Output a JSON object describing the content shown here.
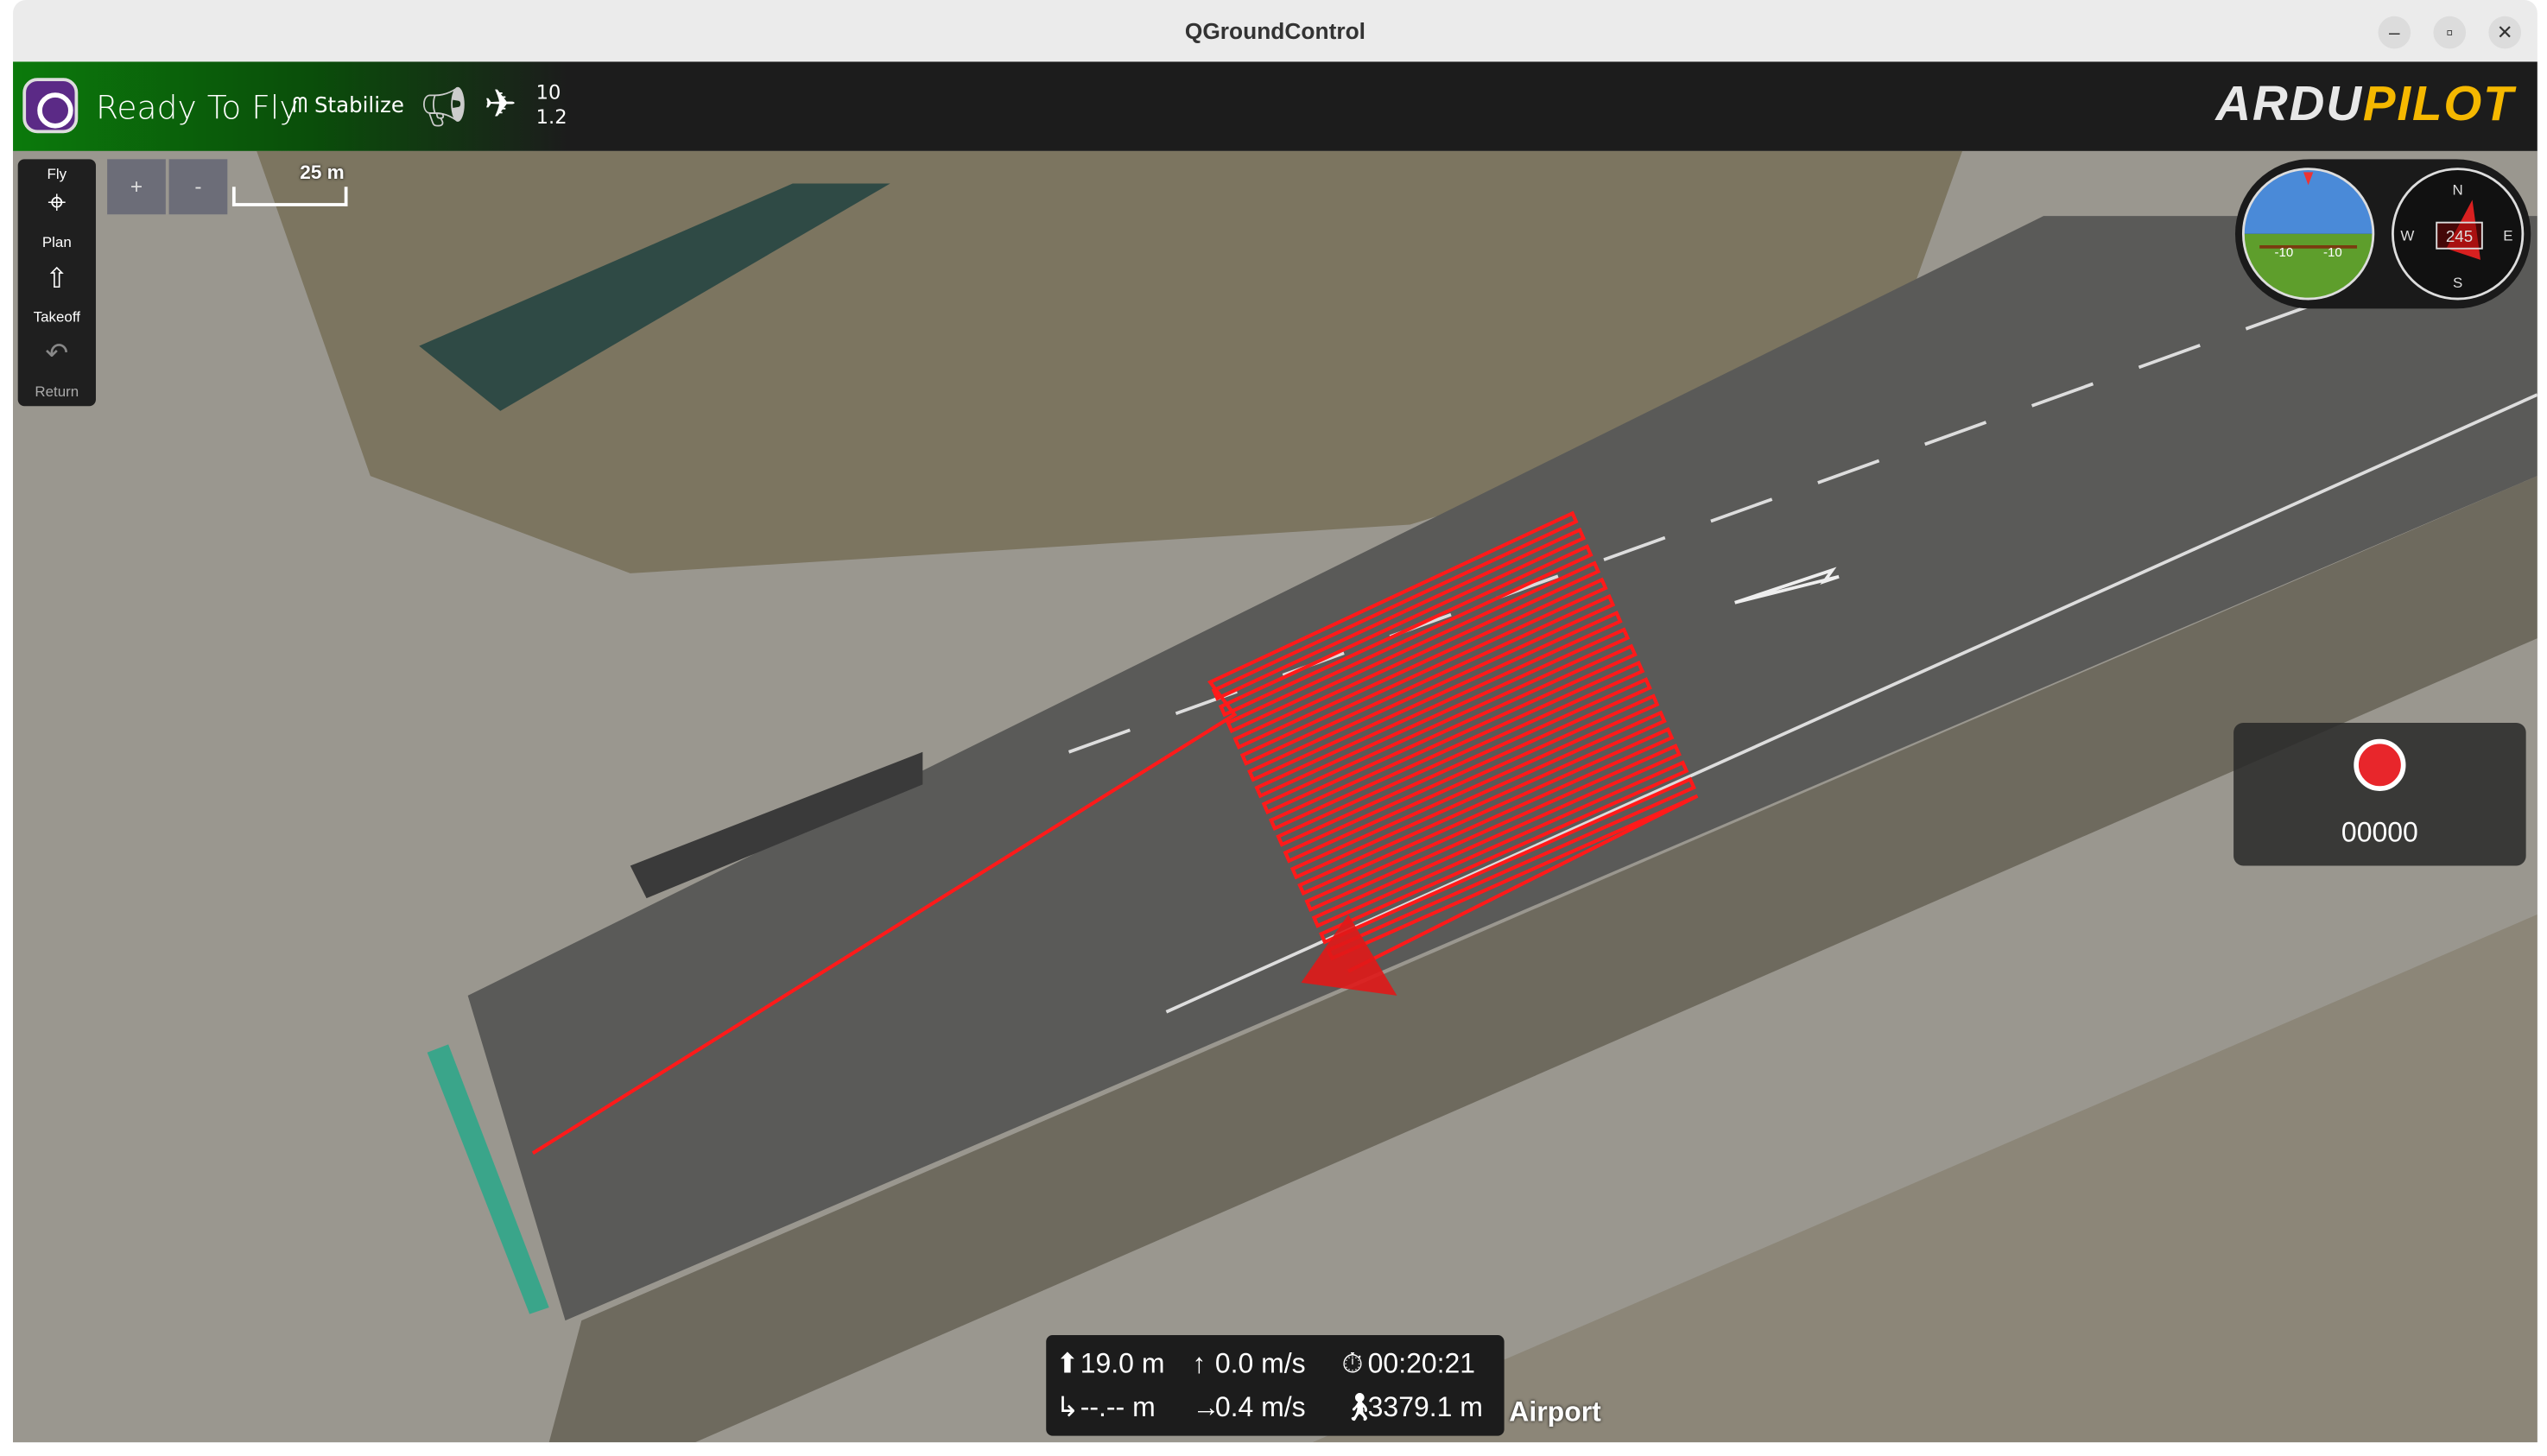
{
  "window": {
    "title": "QGroundControl",
    "minimize": "–",
    "restore": "▫",
    "close": "✕"
  },
  "toolbar": {
    "status": "Ready To Fly",
    "flight_mode": "Stabilize",
    "gps_count": "10",
    "gps_hdop": "1.2",
    "logo": "ARDUPILOT"
  },
  "sidebar": {
    "items": [
      {
        "label": "Fly"
      },
      {
        "label": "Plan"
      },
      {
        "label": "Takeoff"
      },
      {
        "label": "Return"
      }
    ]
  },
  "map_controls": {
    "zoom_in": "+",
    "zoom_out": "-",
    "scale": "25 m"
  },
  "instruments": {
    "attitude_labels": [
      "-10",
      "-10"
    ],
    "compass": {
      "n": "N",
      "e": "E",
      "s": "S",
      "w": "W",
      "heading": "245"
    }
  },
  "recording": {
    "counter": "00000"
  },
  "telemetry": {
    "altitude": "19.0 m",
    "vertical_speed": "0.0 m/s",
    "flight_time": "00:20:21",
    "distance_to_home": "--.-- m",
    "ground_speed": "0.4 m/s",
    "distance_traveled": "3379.1 m"
  },
  "map": {
    "place_label": "Airport",
    "track_color": "#ff1a1a"
  }
}
